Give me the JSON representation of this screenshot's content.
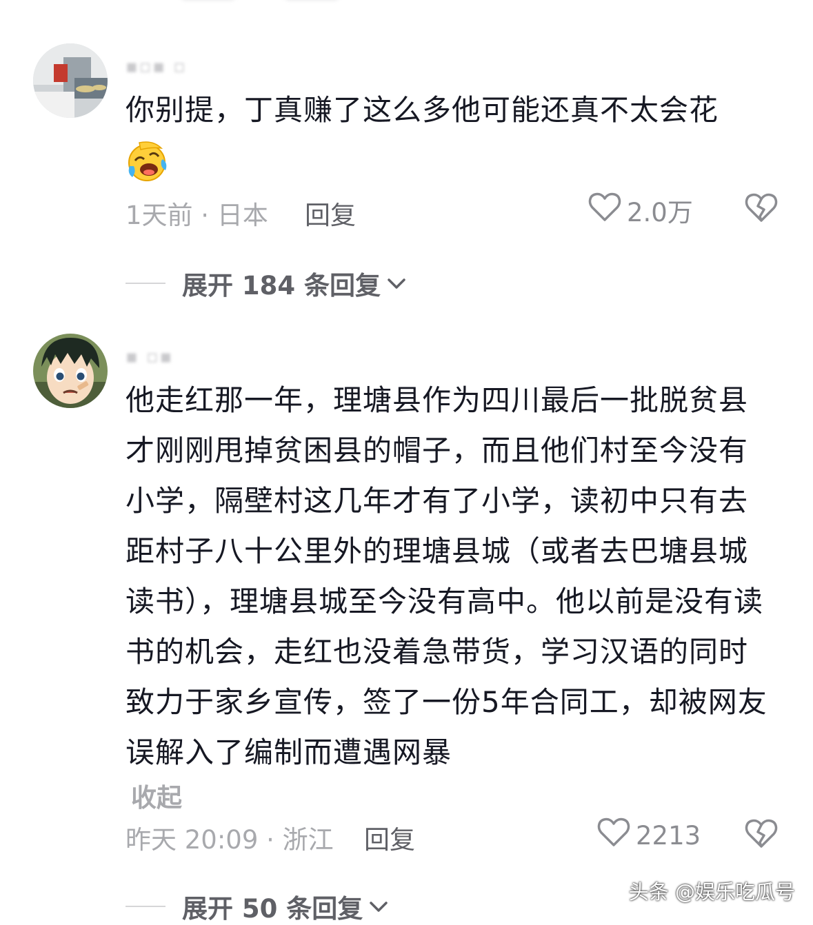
{
  "comments": [
    {
      "text": "你别提，丁真赚了这么多他可能还真不太会花",
      "meta": "1天前 · 日本",
      "reply_label": "回复",
      "likes": "2.0万",
      "expand_label": "展开 184 条回复"
    },
    {
      "text": "他走红那一年，理塘县作为四川最后一批脱贫县才刚刚甩掉贫困县的帽子，而且他们村至今没有小学，隔壁村这几年才有了小学，读初中只有去距村子八十公里外的理塘县城（或者去巴塘县城读书），理塘县城至今没有高中。他以前是没有读书的机会，走红也没着急带货，学习汉语的同时致力于家乡宣传，签了一份5年合同工，却被网友误解入了编制而遭遇网暴",
      "collapse_label": "收起",
      "meta": "昨天 20:09 · 浙江",
      "reply_label": "回复",
      "likes": "2213",
      "expand_label": "展开 50 条回复"
    }
  ],
  "watermark": "头条 @娱乐吃瓜号",
  "icons": {
    "emoji": "laughing-crying-emoji-icon",
    "like": "heart-outline-icon",
    "dislike": "broken-heart-icon",
    "expand": "chevron-down-icon"
  },
  "colors": {
    "text": "#161823",
    "meta": "#a8a9ad",
    "action": "#5f6066",
    "background": "#ffffff"
  }
}
